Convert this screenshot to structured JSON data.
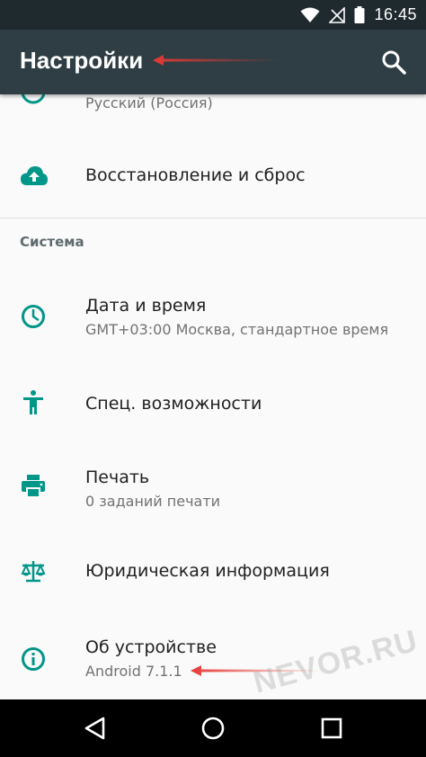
{
  "status_bar": {
    "time": "16:45"
  },
  "app_bar": {
    "title": "Настройки"
  },
  "items": {
    "language": {
      "subtitle": "Русский (Россия)"
    },
    "backup": {
      "title": "Восстановление и сброс"
    },
    "section_system": "Система",
    "datetime": {
      "title": "Дата и время",
      "subtitle": "GMT+03:00 Москва, стандартное время"
    },
    "accessibility": {
      "title": "Спец. возможности"
    },
    "printing": {
      "title": "Печать",
      "subtitle": "0 заданий печати"
    },
    "legal": {
      "title": "Юридическая информация"
    },
    "about": {
      "title": "Об устройстве",
      "subtitle": "Android 7.1.1"
    }
  },
  "watermark": "NEVOR.RU",
  "colors": {
    "accent": "#009688",
    "app_bar": "#2f3e44",
    "status_bar": "#1f2a2e",
    "arrow": "#e53935"
  }
}
